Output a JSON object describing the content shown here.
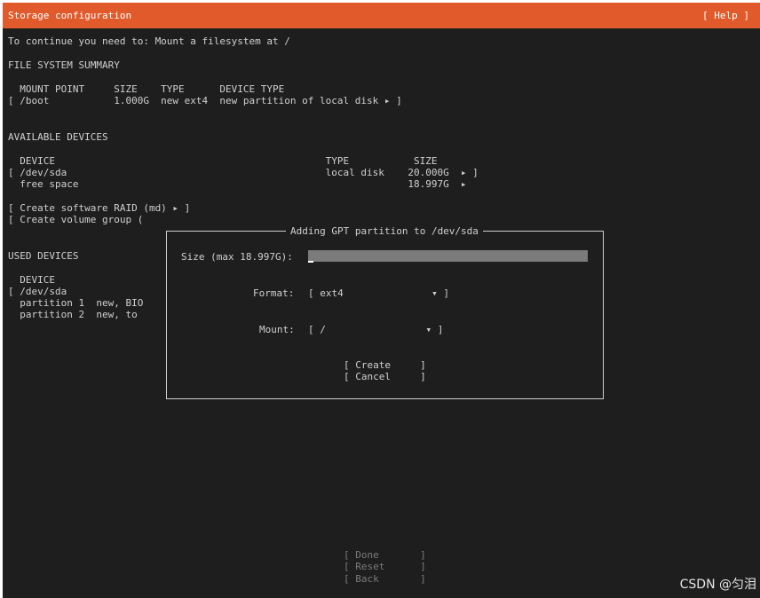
{
  "title_bar": {
    "title": "Storage configuration",
    "help": "[ Help ]"
  },
  "instruction": "To continue you need to: Mount a filesystem at /",
  "fs_summary": {
    "heading": "FILE SYSTEM SUMMARY",
    "header_row": "  MOUNT POINT     SIZE    TYPE      DEVICE TYPE",
    "rows": [
      "[ /boot           1.000G  new ext4  new partition of local disk ▸ ]"
    ]
  },
  "available_devices": {
    "heading": "AVAILABLE DEVICES",
    "header_row": "  DEVICE                                              TYPE           SIZE",
    "sda_row": "[ /dev/sda                                            local disk    20.000G  ▸ ]",
    "free_row": "  free space                                                        18.997G  ▸",
    "raid": "[ Create software RAID (md) ▸ ]",
    "volume_group": "[ Create volume group ("
  },
  "used_devices": {
    "heading": "USED DEVICES",
    "header_row": "  DEVICE",
    "sda_row": "[ /dev/sda",
    "partition1": "  partition 1  new, BIO",
    "partition2": "  partition 2  new, to"
  },
  "dialog": {
    "title": "Adding GPT partition to /dev/sda",
    "size_label": "Size (max 18.997G):",
    "size_value": "",
    "format_label": "Format:",
    "format_value": "[ ext4               ▾ ]",
    "mount_label": "Mount:",
    "mount_value": "[ /                 ▾ ]",
    "create": "[ Create     ]",
    "cancel": "[ Cancel     ]"
  },
  "footer": {
    "done": "[ Done       ]",
    "reset": "[ Reset      ]",
    "back": "[ Back       ]"
  },
  "watermark": "CSDN @匀泪",
  "colors": {
    "title_bar": "#e05a2b",
    "background": "#1e1e1e",
    "input_field": "#7b7b7b"
  }
}
